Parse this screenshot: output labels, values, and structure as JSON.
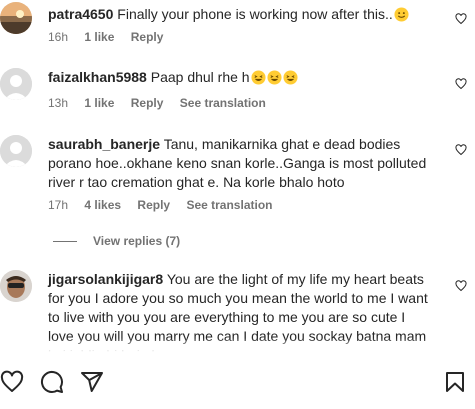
{
  "comments": [
    {
      "username": "patra4650",
      "text": "Finally your phone is working now after this..",
      "emoji": [
        "smiling-face-emoji"
      ],
      "time": "16h",
      "likes": "1 like",
      "reply": "Reply",
      "translation": ""
    },
    {
      "username": "faizalkhan5988",
      "text": "Paap dhul rhe h",
      "emoji": [
        "laughing-face-emoji",
        "laughing-face-emoji",
        "laughing-face-emoji"
      ],
      "time": "13h",
      "likes": "1 like",
      "reply": "Reply",
      "translation": "See translation"
    },
    {
      "username": "saurabh_banerje",
      "text": "Tanu, manikarnika ghat e dead bodies porano hoe..okhane keno snan korle..Ganga is most polluted river r tao cremation ghat e. Na korle bhalo hoto",
      "emoji": [],
      "time": "17h",
      "likes": "4 likes",
      "reply": "Reply",
      "translation": "See translation",
      "view_replies": "View replies (7)"
    },
    {
      "username": "jigarsolankijigar8",
      "text": "You are the light of my life my heart beats for you I adore you so much you mean the world to me I want to live with you you are everything to me you are so cute I love you will you marry me can I date you sockay batna mam koi jaldi nhi hai ok",
      "emoji": []
    }
  ],
  "actions": {
    "like": "heart-icon",
    "comment": "comment-icon",
    "share": "share-icon",
    "save": "bookmark-icon"
  },
  "colors": {
    "text": "#262626",
    "secondary": "#737373",
    "avatar_placeholder": "#dbdbdb"
  }
}
